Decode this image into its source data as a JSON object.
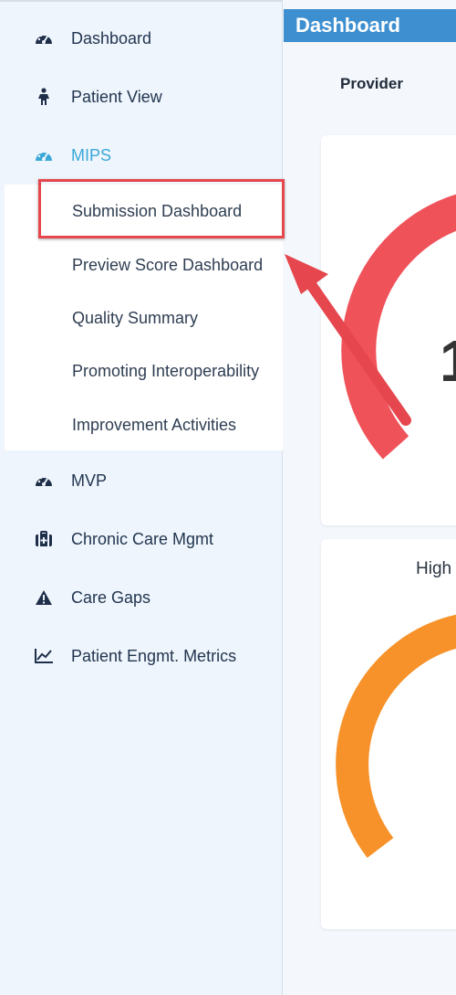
{
  "sidebar": {
    "items": [
      {
        "label": "Dashboard",
        "icon": "gauge-icon"
      },
      {
        "label": "Patient View",
        "icon": "person-icon"
      },
      {
        "label": "MIPS",
        "icon": "gauge-icon",
        "active": true
      },
      {
        "label": "MVP",
        "icon": "gauge-icon"
      },
      {
        "label": "Chronic Care Mgmt",
        "icon": "medical-kit-icon"
      },
      {
        "label": "Care Gaps",
        "icon": "warning-icon"
      },
      {
        "label": "Patient Engmt. Metrics",
        "icon": "line-chart-icon"
      }
    ],
    "mips_submenu": [
      {
        "label": "Submission Dashboard",
        "highlighted": true
      },
      {
        "label": "Preview Score Dashboard"
      },
      {
        "label": "Quality Summary"
      },
      {
        "label": "Promoting Interoperability"
      },
      {
        "label": "Improvement Activities"
      }
    ]
  },
  "main": {
    "header_title": "Dashboard",
    "provider_label": "Provider",
    "cards": [
      {
        "title": "",
        "gauge_color": "#f0525a",
        "gauge_text": "1"
      },
      {
        "title": "High",
        "gauge_color": "#f7922a"
      }
    ]
  },
  "colors": {
    "sidebar_bg": "#eef5fc",
    "active_text": "#3aa8d8",
    "header_bg": "#3d8fd0",
    "annotation_red": "#e6464d"
  }
}
